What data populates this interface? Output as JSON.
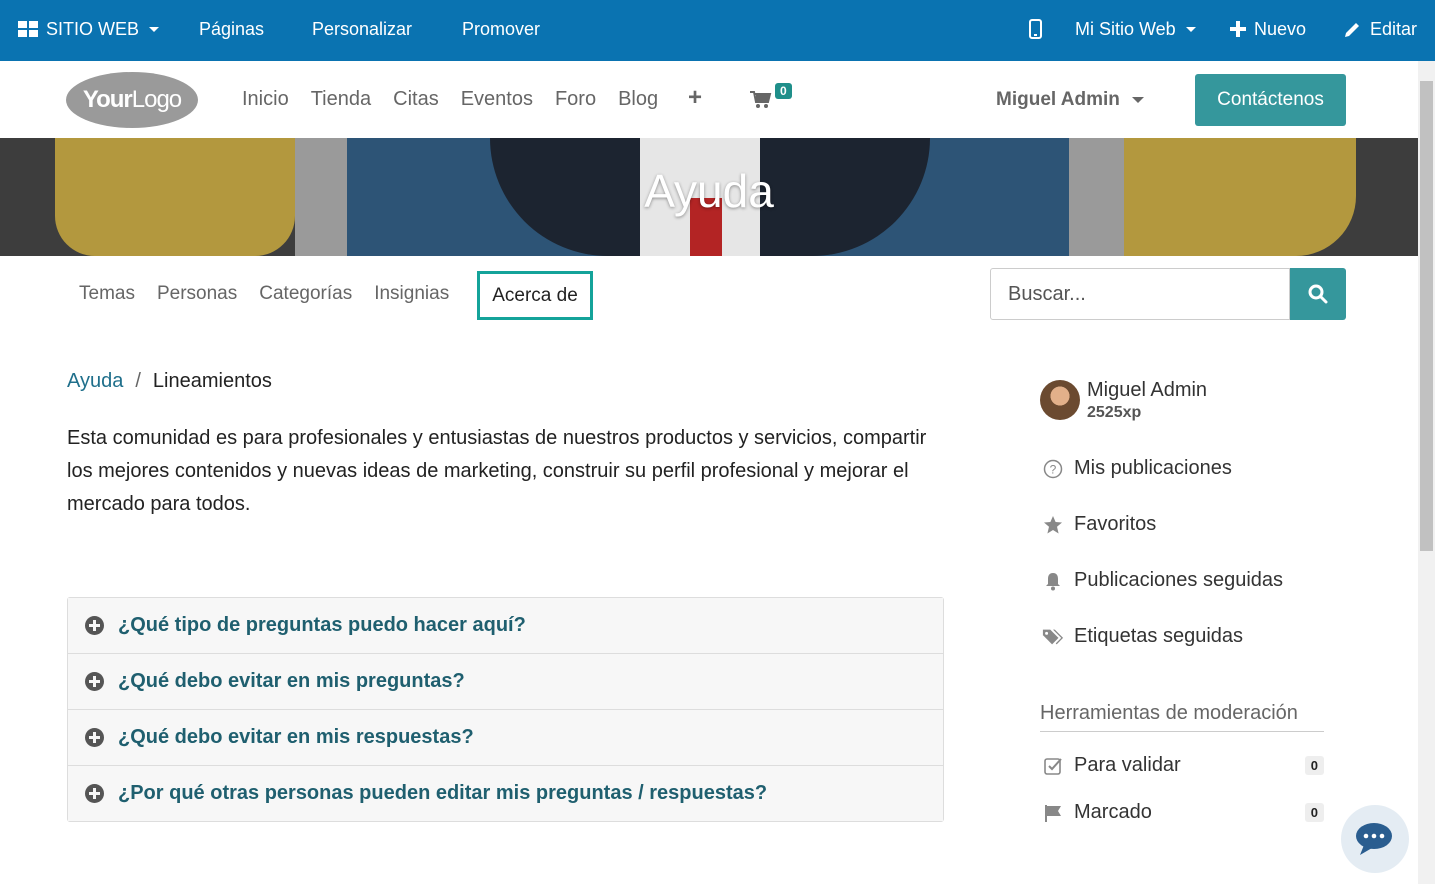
{
  "topbar": {
    "website_menu": "SITIO WEB",
    "pages": "Páginas",
    "customize": "Personalizar",
    "promote": "Promover",
    "my_website": "Mi Sitio Web",
    "new": "Nuevo",
    "edit": "Editar"
  },
  "navbar": {
    "logo_part1": "Your",
    "logo_part2": "Logo",
    "links": [
      "Inicio",
      "Tienda",
      "Citas",
      "Eventos",
      "Foro",
      "Blog"
    ],
    "cart_count": "0",
    "user": "Miguel Admin",
    "contact": "Contáctenos"
  },
  "banner": {
    "title": "Ayuda"
  },
  "subnav": {
    "tabs": [
      "Temas",
      "Personas",
      "Categorías",
      "Insignias"
    ],
    "active_tab": "Acerca de",
    "search_placeholder": "Buscar..."
  },
  "breadcrumb": {
    "root": "Ayuda",
    "separator": "/",
    "current": "Lineamientos"
  },
  "intro": "Esta comunidad es para profesionales y entusiastas de nuestros productos y servicios, compartir los mejores contenidos y nuevas ideas de marketing, construir su perfil profesional y mejorar el mercado para todos.",
  "faq": [
    "¿Qué tipo de preguntas puedo hacer aquí?",
    "¿Qué debo evitar en mis preguntas?",
    "¿Qué debo evitar en mis respuestas?",
    "¿Por qué otras personas pueden editar mis preguntas / respuestas?"
  ],
  "sidebar": {
    "user_name": "Miguel Admin",
    "user_xp": "2525xp",
    "links": [
      "Mis publicaciones",
      "Favoritos",
      "Publicaciones seguidas",
      "Etiquetas seguidas"
    ],
    "moderation_title": "Herramientas de moderación",
    "moderation": [
      {
        "label": "Para validar",
        "count": "0"
      },
      {
        "label": "Marcado",
        "count": "0"
      }
    ]
  },
  "colors": {
    "topbar": "#0a73b1",
    "accent": "#35979c",
    "link": "#1f6f8b"
  }
}
